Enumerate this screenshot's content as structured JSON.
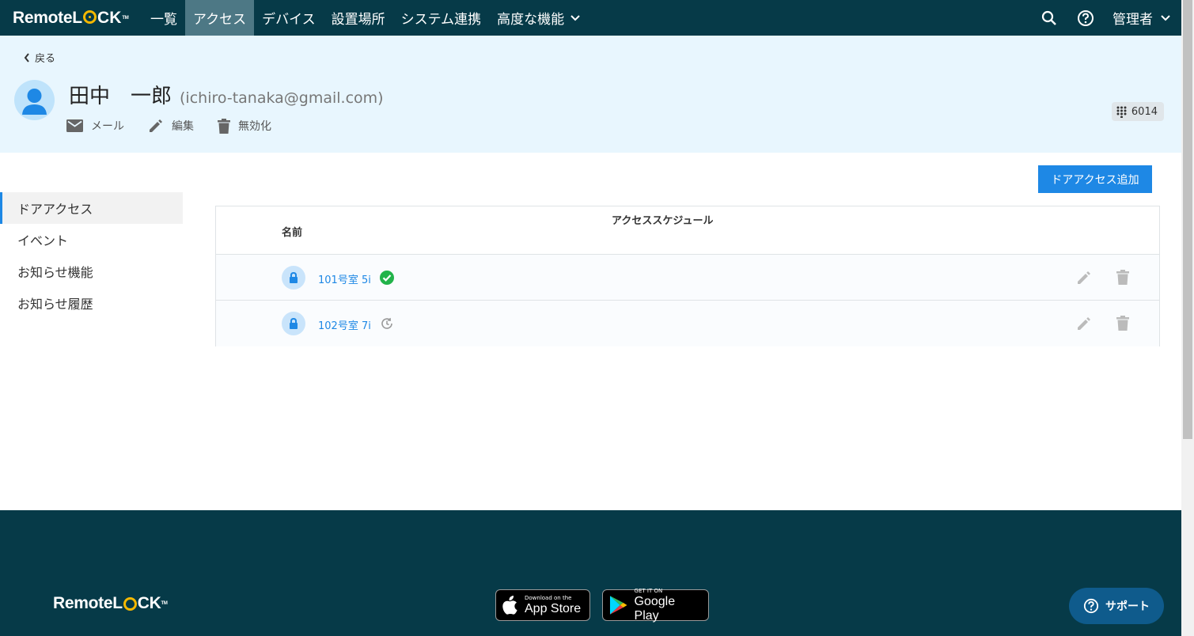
{
  "nav": {
    "brand_a": "Remote",
    "brand_b": "L",
    "brand_c": "CK",
    "items": [
      {
        "label": "一覧"
      },
      {
        "label": "アクセス"
      },
      {
        "label": "デバイス"
      },
      {
        "label": "設置場所"
      },
      {
        "label": "システム連携"
      },
      {
        "label": "高度な機能"
      }
    ],
    "admin_label": "管理者",
    "icons": [
      "search-icon",
      "help-icon",
      "chevron-down-icon"
    ]
  },
  "header": {
    "back_label": "戻る",
    "user_name": "田中　一郎",
    "user_email": "(ichiro-tanaka@gmail.com)",
    "actions": [
      {
        "label": "メール",
        "icon": "mail-icon"
      },
      {
        "label": "編集",
        "icon": "pencil-icon"
      },
      {
        "label": "無効化",
        "icon": "trash-icon"
      }
    ],
    "pin": "6014"
  },
  "sidebar": {
    "items": [
      {
        "label": "ドアアクセス"
      },
      {
        "label": "イベント"
      },
      {
        "label": "お知らせ機能"
      },
      {
        "label": "お知らせ履歴"
      }
    ]
  },
  "main": {
    "add_button": "ドアアクセス追加",
    "columns": {
      "name": "名前",
      "schedule": "アクセススケジュール"
    },
    "rows": [
      {
        "name": "101号室 5i",
        "status": "active"
      },
      {
        "name": "102号室 7i",
        "status": "pending"
      }
    ]
  },
  "footer": {
    "app_store_small": "Download on the",
    "app_store_big": "App Store",
    "google_small": "GET IT ON",
    "google_big": "Google Play",
    "support_label": "サポート"
  },
  "colors": {
    "nav_bg": "#063a48",
    "nav_active": "#4d7885",
    "header_bg": "#e8f6fe",
    "accent": "#1e88e5",
    "success": "#22b34a",
    "brand_yellow": "#f5b800"
  }
}
